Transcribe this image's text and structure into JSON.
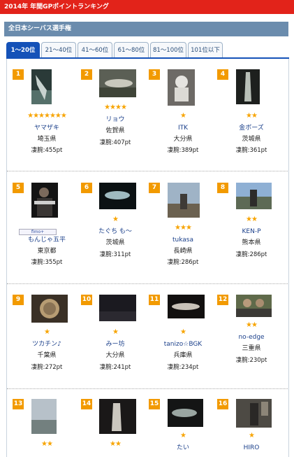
{
  "header": {
    "top_title": "2014年 年間GPポイントランキング",
    "section_title": "全日本シーバス選手権"
  },
  "tabs": [
    {
      "label": "1〜20位"
    },
    {
      "label": "21〜40位"
    },
    {
      "label": "41〜60位"
    },
    {
      "label": "61〜80位"
    },
    {
      "label": "81〜100位"
    },
    {
      "label": "101位以下"
    }
  ],
  "ranking": [
    {
      "rank": "1",
      "stars": "★★★★★★★",
      "name": "ヤマザキ",
      "pref": "埼玉県",
      "points": "凄腕:455pt"
    },
    {
      "rank": "2",
      "stars": "★★★★",
      "name": "リョウ",
      "pref": "佐賀県",
      "points": "凄腕:407pt"
    },
    {
      "rank": "3",
      "stars": "★",
      "name": "ITK",
      "pref": "大分県",
      "points": "凄腕:389pt"
    },
    {
      "rank": "4",
      "stars": "★★",
      "name": "金ボーズ",
      "pref": "茨城県",
      "points": "凄腕:361pt"
    },
    {
      "rank": "5",
      "stars": "",
      "name": "もんじゃ五平",
      "pref": "東京都",
      "points": "凄腕:355pt",
      "badge": "fimo+"
    },
    {
      "rank": "6",
      "stars": "★",
      "name": "たぐち も～",
      "pref": "茨城県",
      "points": "凄腕:311pt"
    },
    {
      "rank": "7",
      "stars": "★★★",
      "name": "tukasa",
      "pref": "長崎県",
      "points": "凄腕:286pt"
    },
    {
      "rank": "8",
      "stars": "★★",
      "name": "KEN-P",
      "pref": "熊本県",
      "points": "凄腕:286pt"
    },
    {
      "rank": "9",
      "stars": "★",
      "name": "ツカチン♪",
      "pref": "千葉県",
      "points": "凄腕:272pt"
    },
    {
      "rank": "10",
      "stars": "★",
      "name": "みー坊",
      "pref": "大分県",
      "points": "凄腕:241pt"
    },
    {
      "rank": "11",
      "stars": "★",
      "name": "tanizo☆BGK",
      "pref": "兵庫県",
      "points": "凄腕:234pt"
    },
    {
      "rank": "12",
      "stars": "★★",
      "name": "no-edge",
      "pref": "三重県",
      "points": "凄腕:230pt"
    },
    {
      "rank": "13",
      "stars": "★★",
      "name": "",
      "pref": "",
      "points": ""
    },
    {
      "rank": "14",
      "stars": "★★",
      "name": "",
      "pref": "",
      "points": ""
    },
    {
      "rank": "15",
      "stars": "★",
      "name": "たい",
      "pref": "",
      "points": ""
    },
    {
      "rank": "16",
      "stars": "★",
      "name": "HIRO",
      "pref": "",
      "points": ""
    }
  ],
  "colors": {
    "top_bar": "#e2231a",
    "section_bar": "#6b8cad",
    "active_tab": "#1552b8",
    "rank_badge": "#f29a00",
    "star": "#f7a400",
    "name_link": "#1a3f8a"
  }
}
